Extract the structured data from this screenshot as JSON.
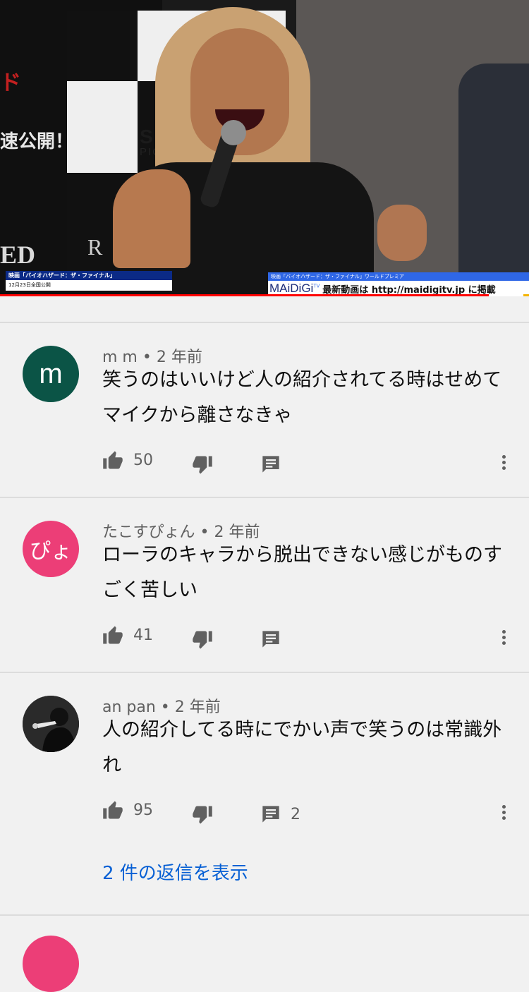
{
  "video": {
    "caption_left_top": "映画「バイオハザード：ザ・ファイナル」",
    "caption_left_bottom": "12月23日全国公開",
    "caption_right_top": "映画「バイオハザード：ザ・ファイナル」ワールドプレミア",
    "logo": "MAiDiGi",
    "logo_sup": "TV",
    "caption_right_msg": "最新動画は http://maidigitv.jp に掲載",
    "poster_text": "速公開！",
    "poster_d": "ド",
    "poster_ed": "ED",
    "sony": "SO",
    "sony2": "PICT",
    "rc": "R",
    "progress_fraction": 0.924
  },
  "comments": [
    {
      "avatar_text": "m",
      "author": "m m",
      "age": "2 年前",
      "text": "笑うのはいいけど人の紹介されてる時はせめてマイクから離さなきゃ",
      "likes": "50",
      "replies_count": ""
    },
    {
      "avatar_text": "ぴょ",
      "author": "たこすぴょん",
      "age": "2 年前",
      "text": "ローラのキャラから脱出できない感じがものすごく苦しい",
      "likes": "41",
      "replies_count": ""
    },
    {
      "avatar_text": "",
      "author": "an pan",
      "age": "2 年前",
      "text": "人の紹介してる時にでかい声で笑うのは常識外れ",
      "likes": "95",
      "replies_count": "2"
    }
  ],
  "show_replies_label": "2 件の返信を表示",
  "icons": {
    "like": "thumbs-up-icon",
    "dislike": "thumbs-down-icon",
    "reply": "comment-icon",
    "more": "more-vert-icon"
  },
  "colors": {
    "progress": "#ff0000",
    "link": "#065fd4",
    "avatar_m": "#0b5446",
    "avatar_pyo": "#ec3e77"
  }
}
